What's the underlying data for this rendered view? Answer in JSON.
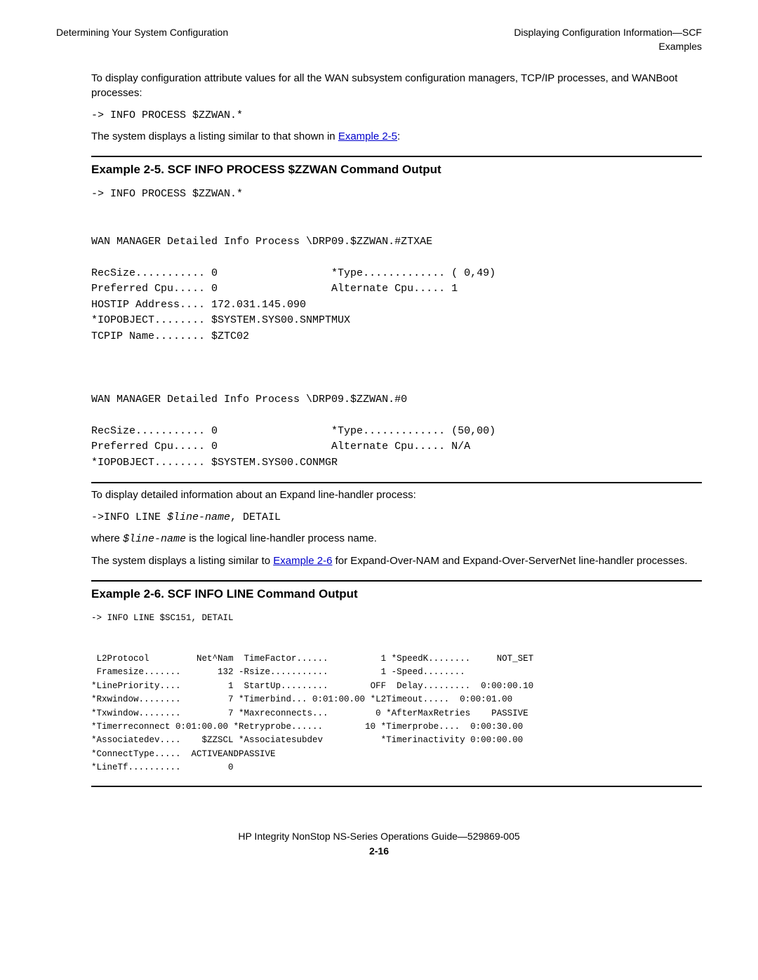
{
  "header": {
    "left": "Determining Your System Configuration",
    "right1": "Displaying Configuration Information—SCF",
    "right2": "Examples"
  },
  "p1": "To display configuration attribute values for all the WAN subsystem configuration managers, TCP/IP processes, and WANBoot processes:",
  "code1": "-> INFO PROCESS $ZZWAN.*",
  "p2a": "The system displays a listing similar to that shown in ",
  "link25": "Example 2-5",
  "p2b": ":",
  "ex25_title": "Example 2-5.  SCF INFO PROCESS $ZZWAN Command Output",
  "ex25_code": "-> INFO PROCESS $ZZWAN.*\n\n\nWAN MANAGER Detailed Info Process \\DRP09.$ZZWAN.#ZTXAE\n\nRecSize........... 0                  *Type............. ( 0,49)\nPreferred Cpu..... 0                  Alternate Cpu..... 1\nHOSTIP Address.... 172.031.145.090\n*IOPOBJECT........ $SYSTEM.SYS00.SNMPTMUX\nTCPIP Name........ $ZTC02\n\n\n\nWAN MANAGER Detailed Info Process \\DRP09.$ZZWAN.#0\n\nRecSize........... 0                  *Type............. (50,00)\nPreferred Cpu..... 0                  Alternate Cpu..... N/A\n*IOPOBJECT........ $SYSTEM.SYS00.CONMGR",
  "p3": "To display detailed information about an Expand line-handler process:",
  "code2a": "->INFO LINE ",
  "code2_it": "$line-name",
  "code2b": ", DETAIL",
  "p4a": "where ",
  "p4_it": "$line-name",
  "p4b": " is the logical line-handler process name.",
  "p5a": "The system displays a listing similar to ",
  "link26": "Example 2-6",
  "p5b": " for Expand-Over-NAM and Expand-Over-ServerNet line-handler processes.",
  "ex26_title": "Example 2-6.  SCF INFO LINE Command Output",
  "ex26_code": "-> INFO LINE $SC151, DETAIL\n\n\n L2Protocol         Net^Nam  TimeFactor......          1 *SpeedK........     NOT_SET\n Framesize.......       132 -Rsize...........          1 -Speed........\n*LinePriority....         1  StartUp.........        OFF  Delay.........  0:00:00.10\n*Rxwindow........         7 *Timerbind... 0:01:00.00 *L2Timeout.....  0:00:01.00\n*Txwindow........         7 *Maxreconnects...         0 *AfterMaxRetries    PASSIVE\n*Timerreconnect 0:01:00.00 *Retryprobe......        10 *Timerprobe....  0:00:30.00\n*Associatedev....    $ZZSCL *Associatesubdev           *Timerinactivity 0:00:00.00\n*ConnectType.....  ACTIVEANDPASSIVE\n*LineTf..........         0",
  "footer": {
    "line1": "HP Integrity NonStop NS-Series Operations Guide—529869-005",
    "page": "2-16"
  }
}
